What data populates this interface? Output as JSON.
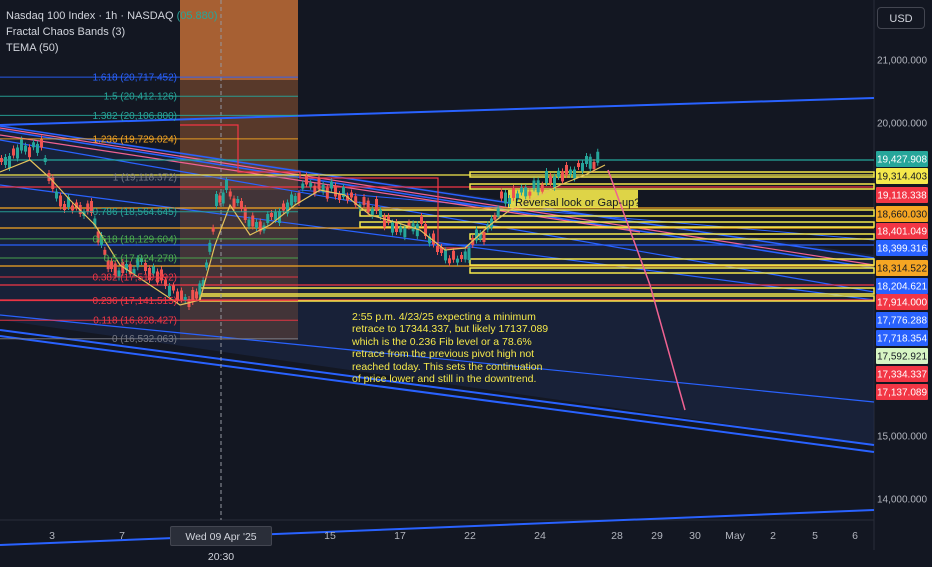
{
  "legend": {
    "line1": "Nasdaq 100 Index · 1h · NASDAQ",
    "line1_value": "(05.880)",
    "line2": "Fractal Chaos Bands (3)",
    "line3": "TEMA (50)"
  },
  "currency_button": "USD",
  "annotation": {
    "lines": [
      "2:55 p.m. 4/23/25 expecting a minimum",
      "retrace to 17344.337, but likely 17137.089",
      "which is the 0.236 Fib level or a 78.6%",
      "retrace from the previous pivot high not",
      "reached today. This sets the continuation",
      "of price lower and still in the downtrend."
    ]
  },
  "reversal_note": "Reversal look or Gap-up?",
  "crosshair_date": "Wed 09 Apr '25   20:30",
  "colors": {
    "background": "#131722",
    "fib_box": "#d9793a",
    "yellow_zone": "#f5e94b",
    "red_line": "#f23645",
    "blue_channel": "#2962ff",
    "teal_fib": "#26a69a",
    "candle_up": "#26a69a",
    "candle_down": "#ef5350",
    "tema": "#e5c35b"
  },
  "chart_data": {
    "type": "line",
    "title": "Nasdaq 100 Index · 1h · NASDAQ",
    "y_axis_ticks": [
      "21,000.000",
      "20,000.000",
      "15,000.000",
      "14,000.000"
    ],
    "x_axis_ticks": [
      "3",
      "7",
      "15",
      "17",
      "22",
      "24",
      "28",
      "29",
      "30",
      "May",
      "2",
      "5",
      "6"
    ],
    "fib_levels": [
      {
        "ratio": "1.618",
        "value": 20717.452,
        "label": "1.618 (20,717.452)",
        "color": "#2962ff"
      },
      {
        "ratio": "1.5",
        "value": 20412.126,
        "label": "1.5 (20,412.126)",
        "color": "#26a69a"
      },
      {
        "ratio": "1.382",
        "value": 20106.8,
        "label": "1.382 (20,106.800)",
        "color": "#26a69a"
      },
      {
        "ratio": "1.236",
        "value": 19729.024,
        "label": "1.236 (19,729.024)",
        "color": "#f5a623"
      },
      {
        "ratio": "1",
        "value": 19118.372,
        "label": "1 (19,118.372)",
        "color": "#787b86"
      },
      {
        "ratio": "0.786",
        "value": 18564.645,
        "label": "0.786 (18,564.645)",
        "color": "#26a69a"
      },
      {
        "ratio": "0.618",
        "value": 18129.604,
        "label": "0.618 (18,129.604)",
        "color": "#4caf50"
      },
      {
        "ratio": "0.5",
        "value": 17824.278,
        "label": "0.5 (17,824.278)",
        "color": "#4caf50"
      },
      {
        "ratio": "0.382",
        "value": 17519.292,
        "label": "0.382 (17,519.292)",
        "color": "#f23645"
      },
      {
        "ratio": "0.236",
        "value": 17141.515,
        "label": "0.236 (17,141.515)",
        "color": "#f23645"
      },
      {
        "ratio": "0.118",
        "value": 16828.427,
        "label": "0.118 (16,828.427)",
        "color": "#f23645"
      },
      {
        "ratio": "0",
        "value": 16532.063,
        "label": "0 (16,532.063)",
        "color": "#787b86"
      }
    ],
    "price_labels": [
      {
        "value": "19,427.908",
        "bg": "#26a69a",
        "fg": "#ffffff"
      },
      {
        "value": "19,314.403",
        "bg": "#f5e94b",
        "fg": "#131722"
      },
      {
        "value": "19,118.338",
        "bg": "#f23645",
        "fg": "#ffffff"
      },
      {
        "value": "18,660.030",
        "bg": "#f5a623",
        "fg": "#131722"
      },
      {
        "value": "18,401.049",
        "bg": "#f23645",
        "fg": "#ffffff"
      },
      {
        "value": "18,399.316",
        "bg": "#2962ff",
        "fg": "#ffffff"
      },
      {
        "value": "18,314.522",
        "bg": "#f5a623",
        "fg": "#131722"
      },
      {
        "value": "18,204.621",
        "bg": "#2962ff",
        "fg": "#ffffff"
      },
      {
        "value": "17,914.000",
        "bg": "#f23645",
        "fg": "#ffffff"
      },
      {
        "value": "17,776.288",
        "bg": "#2962ff",
        "fg": "#ffffff"
      },
      {
        "value": "17,718.354",
        "bg": "#2962ff",
        "fg": "#ffffff"
      },
      {
        "value": "17,592.921",
        "bg": "#d7f5c4",
        "fg": "#131722"
      },
      {
        "value": "17,334.337",
        "bg": "#f23645",
        "fg": "#ffffff"
      },
      {
        "value": "17,137.089",
        "bg": "#f23645",
        "fg": "#ffffff"
      }
    ],
    "grid": false,
    "legend_position": "top-left"
  }
}
